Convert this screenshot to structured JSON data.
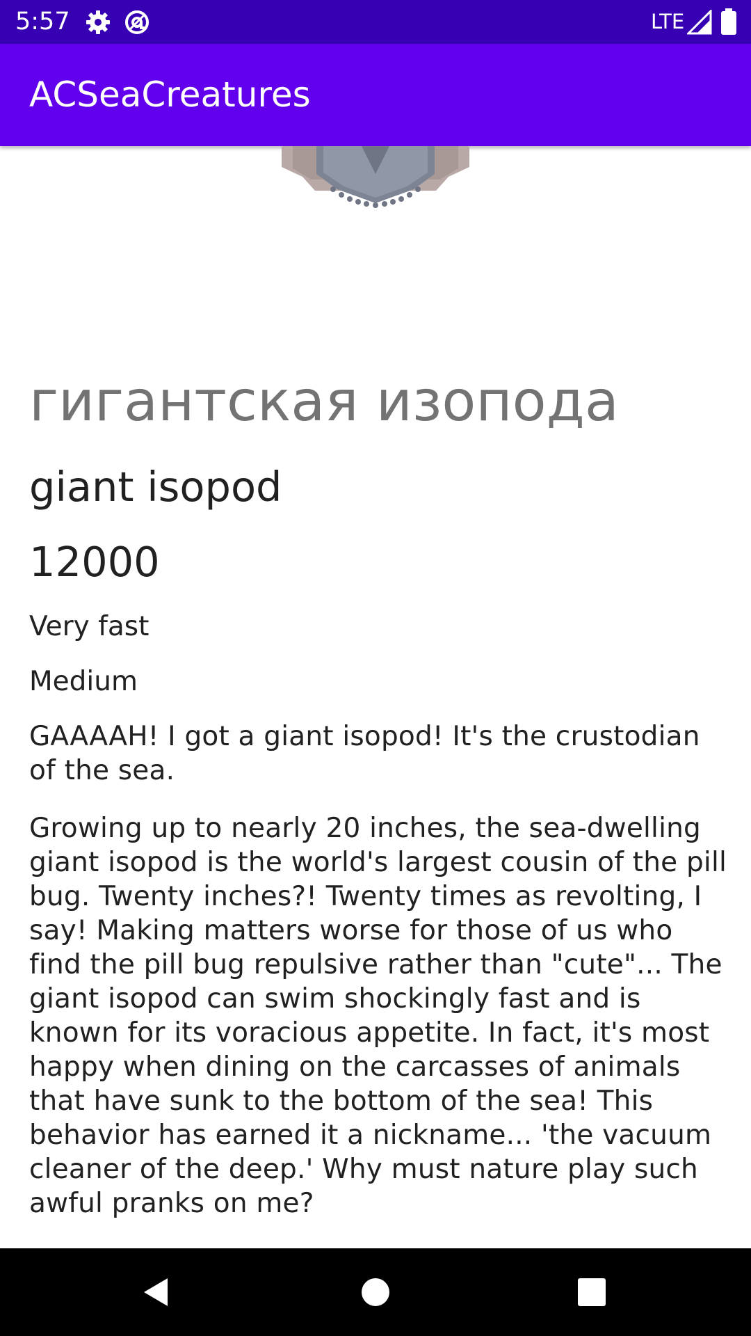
{
  "status_bar": {
    "time": "5:57",
    "network": "LTE",
    "icons": [
      "gear-icon",
      "at-sign-icon",
      "signal-icon",
      "battery-icon"
    ]
  },
  "app_bar": {
    "title": "ACSeaCreatures",
    "color": "#6200ee"
  },
  "creature": {
    "image_icon": "giant-isopod-image",
    "name_ru": "гигантская изопода",
    "name_en": "giant isopod",
    "price": "12000",
    "speed": "Very fast",
    "shadow": "Medium",
    "catch_phrase": "GAAAAH! I got a giant isopod! It's the crustodian of the sea.",
    "museum_phrase": "Growing up to nearly 20 inches, the sea-dwelling giant isopod is the world's largest cousin of the pill bug. Twenty inches?! Twenty times as revolting, I say! Making matters worse for those of us who find the pill bug repulsive rather than \"cute\"... The giant isopod can swim shockingly fast and is known for its voracious appetite. In fact, it's most happy when dining on the carcasses of animals that have sunk to the bottom of the sea! This behavior has earned it a nickname... 'the vacuum cleaner of the deep.' Why must nature play such awful pranks on me?"
  },
  "nav_bar": {
    "buttons": [
      "back-icon",
      "home-icon",
      "recents-icon"
    ]
  },
  "colors": {
    "status_bar": "#3700b3",
    "app_bar": "#6200ee",
    "russian_name_text": "#737373",
    "body_text": "#212121"
  }
}
